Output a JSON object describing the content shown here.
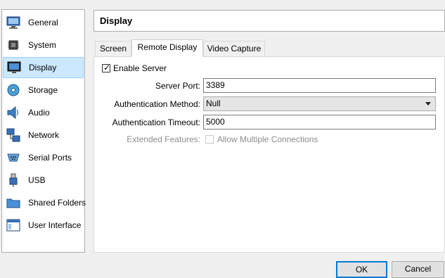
{
  "sidebar": {
    "items": [
      {
        "label": "General",
        "icon": "monitor-general-icon"
      },
      {
        "label": "System",
        "icon": "chip-icon"
      },
      {
        "label": "Display",
        "icon": "display-icon"
      },
      {
        "label": "Storage",
        "icon": "storage-disc-icon"
      },
      {
        "label": "Audio",
        "icon": "speaker-icon"
      },
      {
        "label": "Network",
        "icon": "network-icon"
      },
      {
        "label": "Serial Ports",
        "icon": "serial-plug-icon"
      },
      {
        "label": "USB",
        "icon": "usb-icon"
      },
      {
        "label": "Shared Folders",
        "icon": "folder-icon"
      },
      {
        "label": "User Interface",
        "icon": "window-icon"
      }
    ],
    "selected": "Display"
  },
  "header": {
    "title": "Display"
  },
  "tabs": [
    {
      "label": "Screen"
    },
    {
      "label": "Remote Display"
    },
    {
      "label": "Video Capture"
    }
  ],
  "active_tab": "Remote Display",
  "form": {
    "enable_server_label": "Enable Server",
    "enable_server_checked": true,
    "server_port_label": "Server Port:",
    "server_port_value": "3389",
    "auth_method_label": "Authentication Method:",
    "auth_method_value": "Null",
    "auth_timeout_label": "Authentication Timeout:",
    "auth_timeout_value": "5000",
    "extended_features_label": "Extended Features:",
    "allow_multiple_label": "Allow Multiple Connections",
    "allow_multiple_checked": false
  },
  "buttons": {
    "ok": "OK",
    "cancel": "Cancel"
  },
  "colors": {
    "selection_bg": "#cce8ff",
    "selection_border": "#99d1ff",
    "default_button_border": "#0078d7"
  }
}
